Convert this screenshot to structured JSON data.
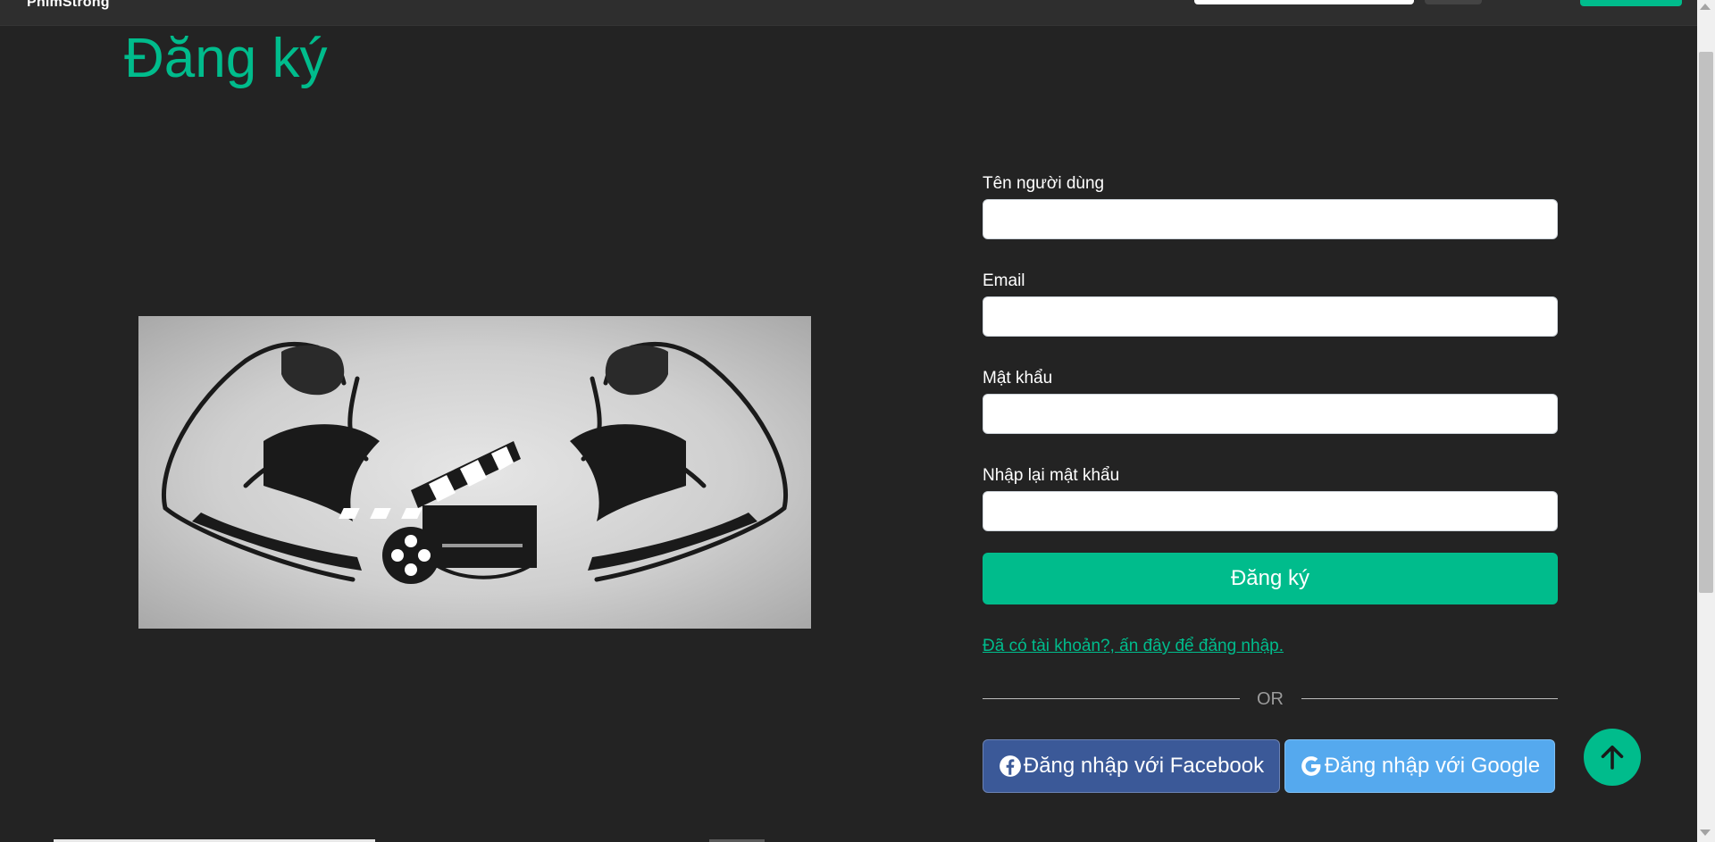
{
  "navbar": {
    "brand": "PhimStrong",
    "search_placeholder": ""
  },
  "page": {
    "title": "Đăng ký"
  },
  "illustration": {
    "alt": "PhimStrong logo"
  },
  "form": {
    "fields": [
      {
        "label": "Tên người dùng",
        "value": ""
      },
      {
        "label": "Email",
        "value": ""
      },
      {
        "label": "Mật khẩu",
        "value": ""
      },
      {
        "label": "Nhập lại mật khẩu",
        "value": ""
      }
    ],
    "submit_label": "Đăng ký",
    "login_link": "Đã có tài khoản?, ấn đây để đăng nhập.",
    "divider_text": "OR",
    "facebook_label": "Đăng nhập với Facebook",
    "google_label": "Đăng nhập với Google"
  },
  "icons": {
    "facebook": "facebook-icon",
    "google": "google-icon",
    "back_to_top": "arrow-up-icon"
  },
  "colors": {
    "accent": "#00bc8c",
    "background": "#232323",
    "facebook": "#3b5998",
    "google": "#55a9ee"
  }
}
